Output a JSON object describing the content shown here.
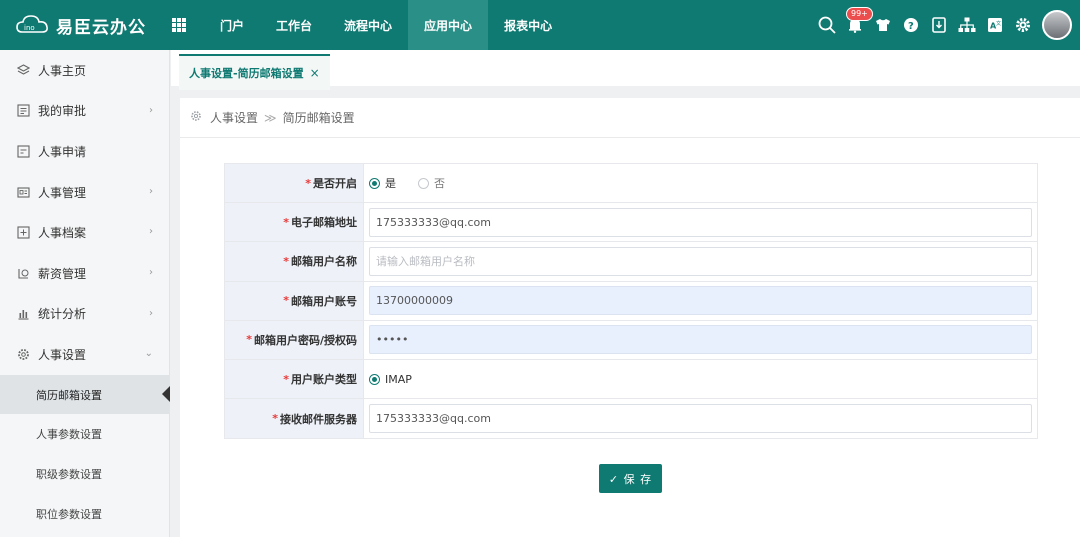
{
  "header": {
    "brand": "易臣云办公",
    "nav": [
      {
        "label": "门户"
      },
      {
        "label": "工作台"
      },
      {
        "label": "流程中心"
      },
      {
        "label": "应用中心",
        "active": true
      },
      {
        "label": "报表中心"
      }
    ],
    "notification_badge": "99+",
    "icons": [
      "search-icon",
      "bell-icon",
      "shirt-icon",
      "help-icon",
      "download-icon",
      "org-chart-icon",
      "translate-icon",
      "gear-icon"
    ]
  },
  "sidebar": {
    "items": [
      {
        "label": "人事主页",
        "icon": "layers-icon"
      },
      {
        "label": "我的审批",
        "icon": "approval-icon",
        "chevron": "›"
      },
      {
        "label": "人事申请",
        "icon": "application-icon"
      },
      {
        "label": "人事管理",
        "icon": "id-card-icon",
        "chevron": "›"
      },
      {
        "label": "人事档案",
        "icon": "archive-icon",
        "chevron": "›"
      },
      {
        "label": "薪资管理",
        "icon": "salary-icon",
        "chevron": "›"
      },
      {
        "label": "统计分析",
        "icon": "bar-chart-icon",
        "chevron": "›"
      },
      {
        "label": "人事设置",
        "icon": "settings-icon",
        "chevron": "⌄"
      }
    ],
    "subitems": [
      {
        "label": "简历邮箱设置",
        "active": true
      },
      {
        "label": "人事参数设置"
      },
      {
        "label": "职级参数设置"
      },
      {
        "label": "职位参数设置"
      }
    ]
  },
  "tab": {
    "label": "人事设置-简历邮箱设置",
    "close": "×"
  },
  "breadcrumb": {
    "first": "人事设置",
    "sep": "≫",
    "second": "简历邮箱设置"
  },
  "form": {
    "required_mark": "*",
    "enabled": {
      "label": "是否开启",
      "yes": "是",
      "no": "否"
    },
    "email": {
      "label": "电子邮箱地址",
      "value": "175333333@qq.com"
    },
    "username": {
      "label": "邮箱用户名称",
      "placeholder": "请输入邮箱用户名称"
    },
    "account": {
      "label": "邮箱用户账号",
      "value": "13700000009"
    },
    "password": {
      "label": "邮箱用户密码/授权码",
      "value": "•••••"
    },
    "account_type": {
      "label": "用户账户类型",
      "value": "IMAP"
    },
    "server": {
      "label": "接收邮件服务器",
      "value": "175333333@qq.com"
    }
  },
  "save_button": {
    "label": "✓ 保 存"
  },
  "colors": {
    "primary": "#0f7a72",
    "required": "#e63a3a",
    "label_bg": "#eef2f8",
    "autofill_bg": "#e8f0fe"
  }
}
